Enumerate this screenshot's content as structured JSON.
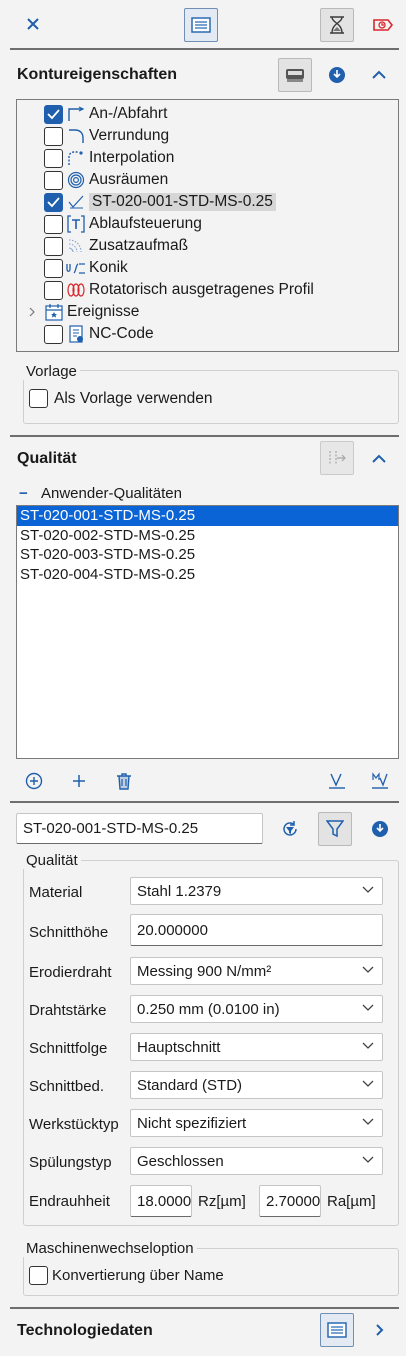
{
  "toolbar": {
    "close_icon": "close-icon",
    "list_icon": "list-view-icon",
    "hourglass_icon": "hourglass-icon",
    "tag_icon": "tag-timer-icon"
  },
  "kontur": {
    "title": "Kontureigenschaften",
    "items": [
      {
        "label": "An-/Abfahrt",
        "checked": true
      },
      {
        "label": "Verrundung",
        "checked": false
      },
      {
        "label": "Interpolation",
        "checked": false
      },
      {
        "label": "Ausräumen",
        "checked": false
      },
      {
        "label": "ST-020-001-STD-MS-0.25",
        "checked": true
      },
      {
        "label": "Ablaufsteuerung",
        "checked": false
      },
      {
        "label": "Zusatzaufmaß",
        "checked": false
      },
      {
        "label": "Konik",
        "checked": false
      },
      {
        "label": "Rotatorisch ausgetragenes Profil",
        "checked": false
      },
      {
        "label": "Ereignisse"
      },
      {
        "label": "NC-Code",
        "checked": false
      }
    ]
  },
  "vorlage": {
    "title": "Vorlage",
    "checkbox_label": "Als Vorlage verwenden"
  },
  "qualitaet": {
    "title": "Qualität",
    "group_label": "Anwender-Qualitäten",
    "collapse_symbol": "−",
    "items": [
      "ST-020-001-STD-MS-0.25",
      "ST-020-002-STD-MS-0.25",
      "ST-020-003-STD-MS-0.25",
      "ST-020-004-STD-MS-0.25"
    ],
    "selected_name": "ST-020-001-STD-MS-0.25"
  },
  "details": {
    "group_title": "Qualität",
    "material_label": "Material",
    "material_value": "Stahl 1.2379",
    "schnitthoehe_label": "Schnitthöhe",
    "schnitthoehe_value": "20.000000",
    "draht_label": "Erodierdraht",
    "draht_value": "Messing 900 N/mm²",
    "staerke_label": "Drahtstärke",
    "staerke_value": "0.250 mm (0.0100 in)",
    "folge_label": "Schnittfolge",
    "folge_value": "Hauptschnitt",
    "bed_label": "Schnittbed.",
    "bed_value": "Standard (STD)",
    "typ_label": "Werkstücktyp",
    "typ_value": "Nicht spezifiziert",
    "spuel_label": "Spülungstyp",
    "spuel_value": "Geschlossen",
    "rau_label": "Endrauhheit",
    "rz_value": "18.0000",
    "rz_unit": "Rz[µm]",
    "ra_value": "2.70000",
    "ra_unit": "Ra[µm]"
  },
  "maschine": {
    "title": "Maschinenwechseloption",
    "checkbox_label": "Konvertierung über Name"
  },
  "technologie": {
    "title": "Technologiedaten"
  },
  "colors": {
    "accent": "#0a64d6",
    "close": "#1f5fad",
    "red_icon": "#d9262c"
  }
}
